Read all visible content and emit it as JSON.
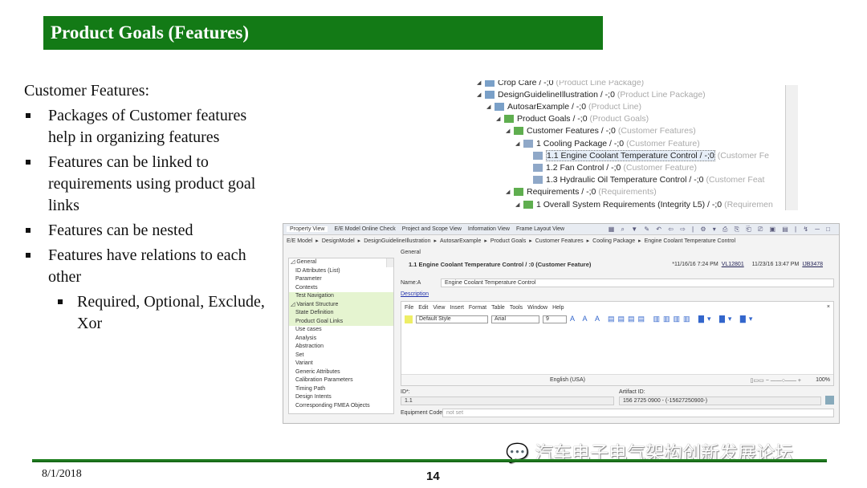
{
  "title": "Product Goals (Features)",
  "left": {
    "heading": "Customer Features:",
    "bullets": [
      "Packages of Customer features help in organizing features",
      "Features can be linked to requirements using product goal links",
      "Features can be nested",
      "Features have relations to each other"
    ],
    "sub_bullets": [
      "Required, Optional, Exclude, Xor"
    ]
  },
  "tree": [
    {
      "label": "Crop Care / -;0",
      "type": "(Product Line Package)",
      "indent": 0,
      "icon": "package-icon"
    },
    {
      "label": "DesignGuidelineIllustration / -;0",
      "type": "(Product Line Package)",
      "indent": 0,
      "icon": "package-icon"
    },
    {
      "label": "AutosarExample / -;0",
      "type": "(Product Line)",
      "indent": 1,
      "icon": "product-line-icon"
    },
    {
      "label": "Product Goals / -;0",
      "type": "(Product Goals)",
      "indent": 2,
      "icon": "folder-icon"
    },
    {
      "label": "Customer Features / -;0",
      "type": "(Customer Features)",
      "indent": 3,
      "icon": "folder-icon"
    },
    {
      "label": "1 Cooling Package / -;0",
      "type": "(Customer Feature)",
      "indent": 4,
      "icon": "feature-icon"
    },
    {
      "label": "1.1 Engine Coolant Temperature Control / -;0",
      "type": "(Customer Fe",
      "indent": 5,
      "icon": "feature-icon",
      "selected": true
    },
    {
      "label": "1.2 Fan Control / -;0",
      "type": "(Customer Feature)",
      "indent": 5,
      "icon": "feature-icon"
    },
    {
      "label": "1.3 Hydraulic Oil Temperature Control / -;0",
      "type": "(Customer Feat",
      "indent": 5,
      "icon": "feature-icon"
    },
    {
      "label": "Requirements / -;0",
      "type": "(Requirements)",
      "indent": 3,
      "icon": "folder-icon"
    },
    {
      "label": "1 Overall System Requirements (Integrity L5) / -;0",
      "type": "(Requiremen",
      "indent": 4,
      "icon": "folder-icon"
    }
  ],
  "property_view": {
    "tabs": [
      "Property View",
      "E/E Model Online Check",
      "Project and Scope View",
      "Information View",
      "Frame Layout View"
    ],
    "breadcrumb": [
      "E/E Model",
      "DesignModel",
      "DesignGuidelineIllustration",
      "AutosarExample",
      "Product Goals",
      "Customer Features",
      "Cooling Package",
      "Engine Coolant Temperature Control"
    ],
    "list": [
      {
        "label": "General",
        "header": true
      },
      {
        "label": "ID Attributes (List)"
      },
      {
        "label": "Parameter"
      },
      {
        "label": "Contexts"
      },
      {
        "label": "Test Navigation",
        "hl": true
      },
      {
        "label": "Variant Structure",
        "header": true,
        "hl": true
      },
      {
        "label": "State Definition",
        "hl": true
      },
      {
        "label": "Product Goal Links",
        "hl": true
      },
      {
        "label": "Use cases"
      },
      {
        "label": "Analysis"
      },
      {
        "label": "Abstraction"
      },
      {
        "label": "Set"
      },
      {
        "label": "Variant"
      },
      {
        "label": "Generic Attributes"
      },
      {
        "label": "Calibration Parameters"
      },
      {
        "label": "Timing Path"
      },
      {
        "label": "Design Intents"
      },
      {
        "label": "Corresponding FMEA Objects"
      }
    ],
    "section": "General",
    "heading": "1.1 Engine Coolant Temperature Control /  :0 (Customer Feature)",
    "created": "*11/16/16 7:24 PM",
    "created_by": "VL12801",
    "modified": "11/23/16 13:47 PM",
    "modified_by": "IJB3478",
    "name_label": "Name:A",
    "name_value": "Engine Coolant Temperature Control",
    "description_link": "Description",
    "editor_menu": [
      "File",
      "Edit",
      "View",
      "Insert",
      "Format",
      "Table",
      "Tools",
      "Window",
      "Help"
    ],
    "style": "Default Style",
    "font": "Arial",
    "size": "9",
    "language": "English (USA)",
    "zoom": "100%",
    "id_label": "ID*:",
    "id_value": "1.1",
    "artifact_label": "Artifact ID:",
    "artifact_value": "156 2725 0900 - (-15627250900-)",
    "equipment_label": "Equipment Code:",
    "equipment_value": "not set"
  },
  "watermark": "汽车电子电气架构创新发展论坛",
  "date": "8/1/2018",
  "page_number": "14",
  "colors": {
    "title_bg": "#137a16",
    "footer_line": "#1f7a20",
    "highlight": "#e5f4d0"
  }
}
